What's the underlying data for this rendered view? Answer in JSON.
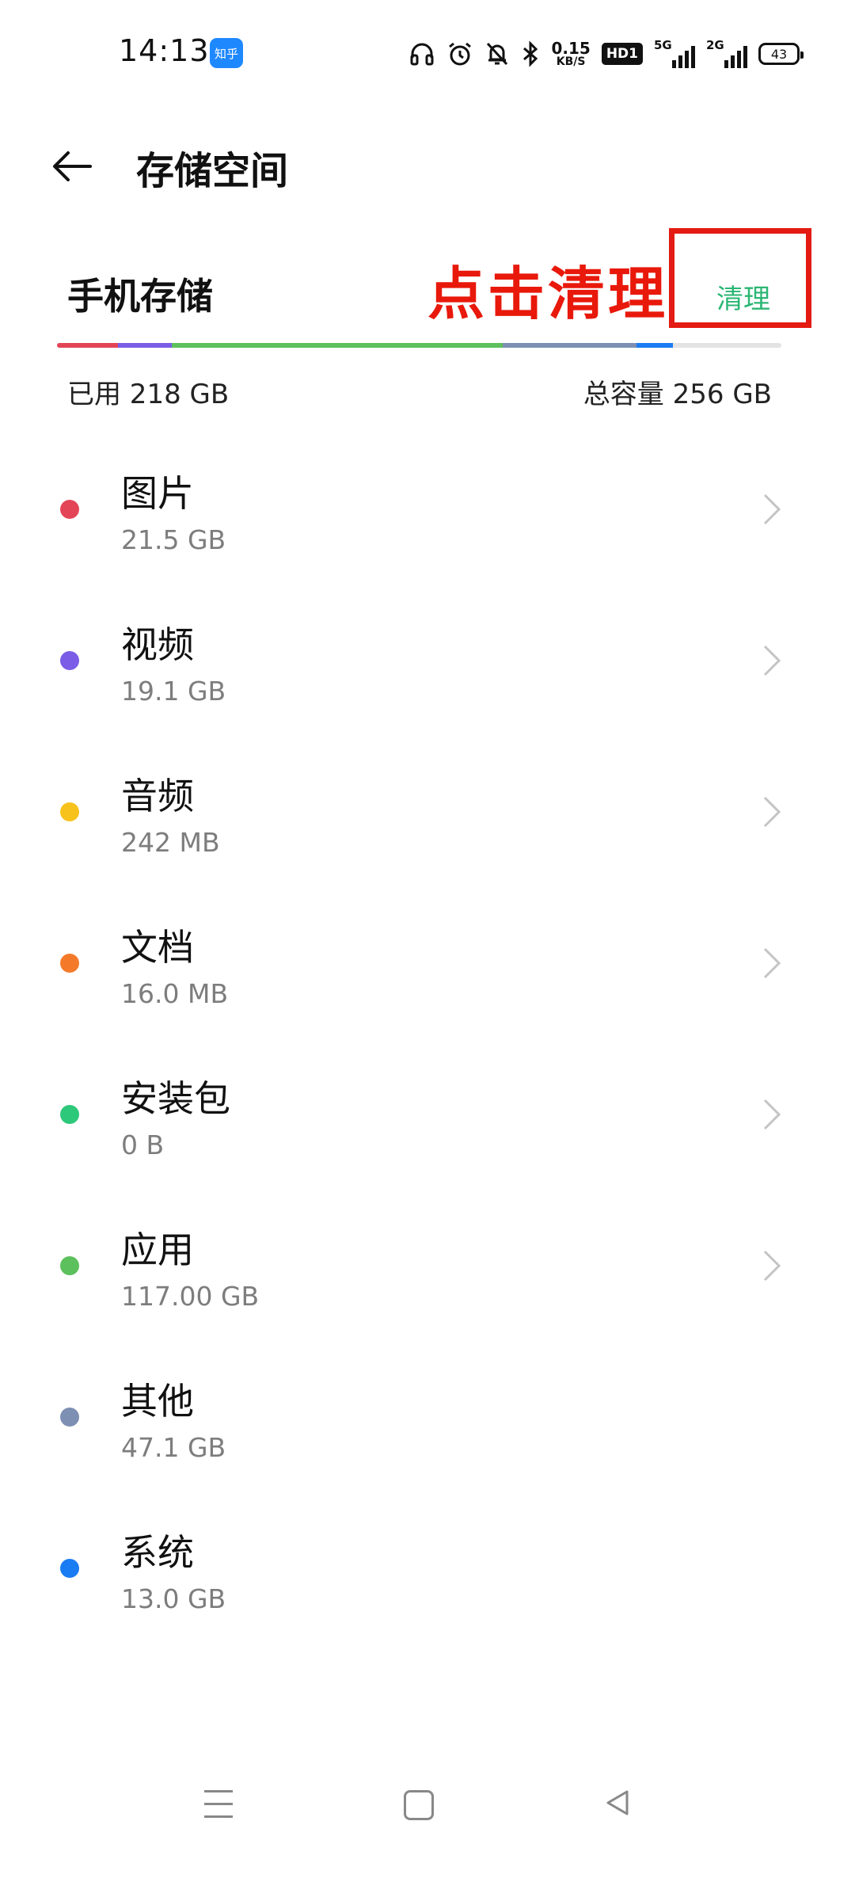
{
  "status_bar": {
    "time": "14:13",
    "app_badge": "知乎",
    "speed_value": "0.15",
    "speed_unit": "KB/S",
    "hd_label": "HD1",
    "sim1_net": "5G",
    "sim2_net": "2G",
    "battery_level": "43"
  },
  "header": {
    "title": "存储空间"
  },
  "storage": {
    "section_title": "手机存储",
    "annotation": "点击清理",
    "clean_label": "清理",
    "used_label": "已用 218 GB",
    "total_label": "总容量 256 GB",
    "usage_segments": [
      {
        "name": "图片",
        "value_gb": 21.5,
        "color": "#e34556"
      },
      {
        "name": "视频",
        "value_gb": 19.1,
        "color": "#7b5ce6"
      },
      {
        "name": "应用",
        "value_gb": 117.0,
        "color": "#5cc05c"
      },
      {
        "name": "其他",
        "value_gb": 47.1,
        "color": "#7d8fb3"
      },
      {
        "name": "系统",
        "value_gb": 13.0,
        "color": "#1a7cf2"
      }
    ],
    "total_gb": 256
  },
  "categories": [
    {
      "name": "图片",
      "size": "21.5 GB",
      "color": "#e34556",
      "has_chevron": true
    },
    {
      "name": "视频",
      "size": "19.1 GB",
      "color": "#7b5ce6",
      "has_chevron": true
    },
    {
      "name": "音频",
      "size": "242 MB",
      "color": "#f8c21c",
      "has_chevron": true
    },
    {
      "name": "文档",
      "size": "16.0 MB",
      "color": "#f47a2a",
      "has_chevron": true
    },
    {
      "name": "安装包",
      "size": "0 B",
      "color": "#2ec87a",
      "has_chevron": true
    },
    {
      "name": "应用",
      "size": "117.00  GB",
      "color": "#5cc05c",
      "has_chevron": true
    },
    {
      "name": "其他",
      "size": "47.1 GB",
      "color": "#7d8fb3",
      "has_chevron": false
    },
    {
      "name": "系统",
      "size": "13.0 GB",
      "color": "#1a7cf2",
      "has_chevron": false
    }
  ],
  "accent_color": "#2bb673",
  "annotation_color": "#e8190b"
}
